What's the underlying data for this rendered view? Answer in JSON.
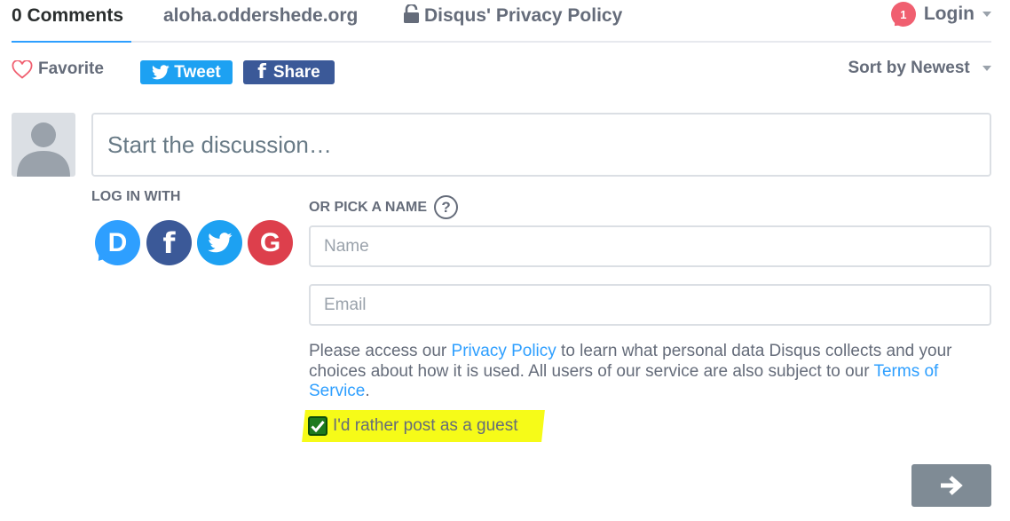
{
  "nav": {
    "comments_tab": "0 Comments",
    "site_tab": "aloha.oddershede.org",
    "privacy_tab": "Disqus' Privacy Policy",
    "notification_count": "1",
    "login_label": "Login"
  },
  "actions": {
    "favorite_label": "Favorite",
    "tweet_label": "Tweet",
    "share_label": "Share",
    "sort_label": "Sort by Newest"
  },
  "composer": {
    "placeholder": "Start the discussion…"
  },
  "auth": {
    "login_with_label": "LOG IN WITH",
    "pick_name_label": "OR PICK A NAME",
    "help_glyph": "?",
    "sso_icons": [
      "disqus-icon",
      "facebook-icon",
      "twitter-icon",
      "google-icon"
    ],
    "sso_glyphs": {
      "disqus": "D",
      "facebook": "f",
      "google": "G"
    }
  },
  "guest_form": {
    "name_placeholder": "Name",
    "email_placeholder": "Email",
    "privacy_text_1": "Please access our ",
    "privacy_link": "Privacy Policy",
    "privacy_text_2": " to learn what personal data Disqus collects and your choices about how it is used. All users of our service are also subject to our ",
    "terms_link": "Terms of Service",
    "privacy_text_3": ".",
    "guest_checkbox_label": "I'd rather post as a guest",
    "guest_checked": true
  },
  "colors": {
    "accent": "#2e9fff",
    "twitter": "#1da1f2",
    "facebook": "#3b5998",
    "google": "#dd3f4c",
    "highlight": "#f6fb18",
    "submit": "#7f8b95",
    "badge": "#f05f70"
  }
}
